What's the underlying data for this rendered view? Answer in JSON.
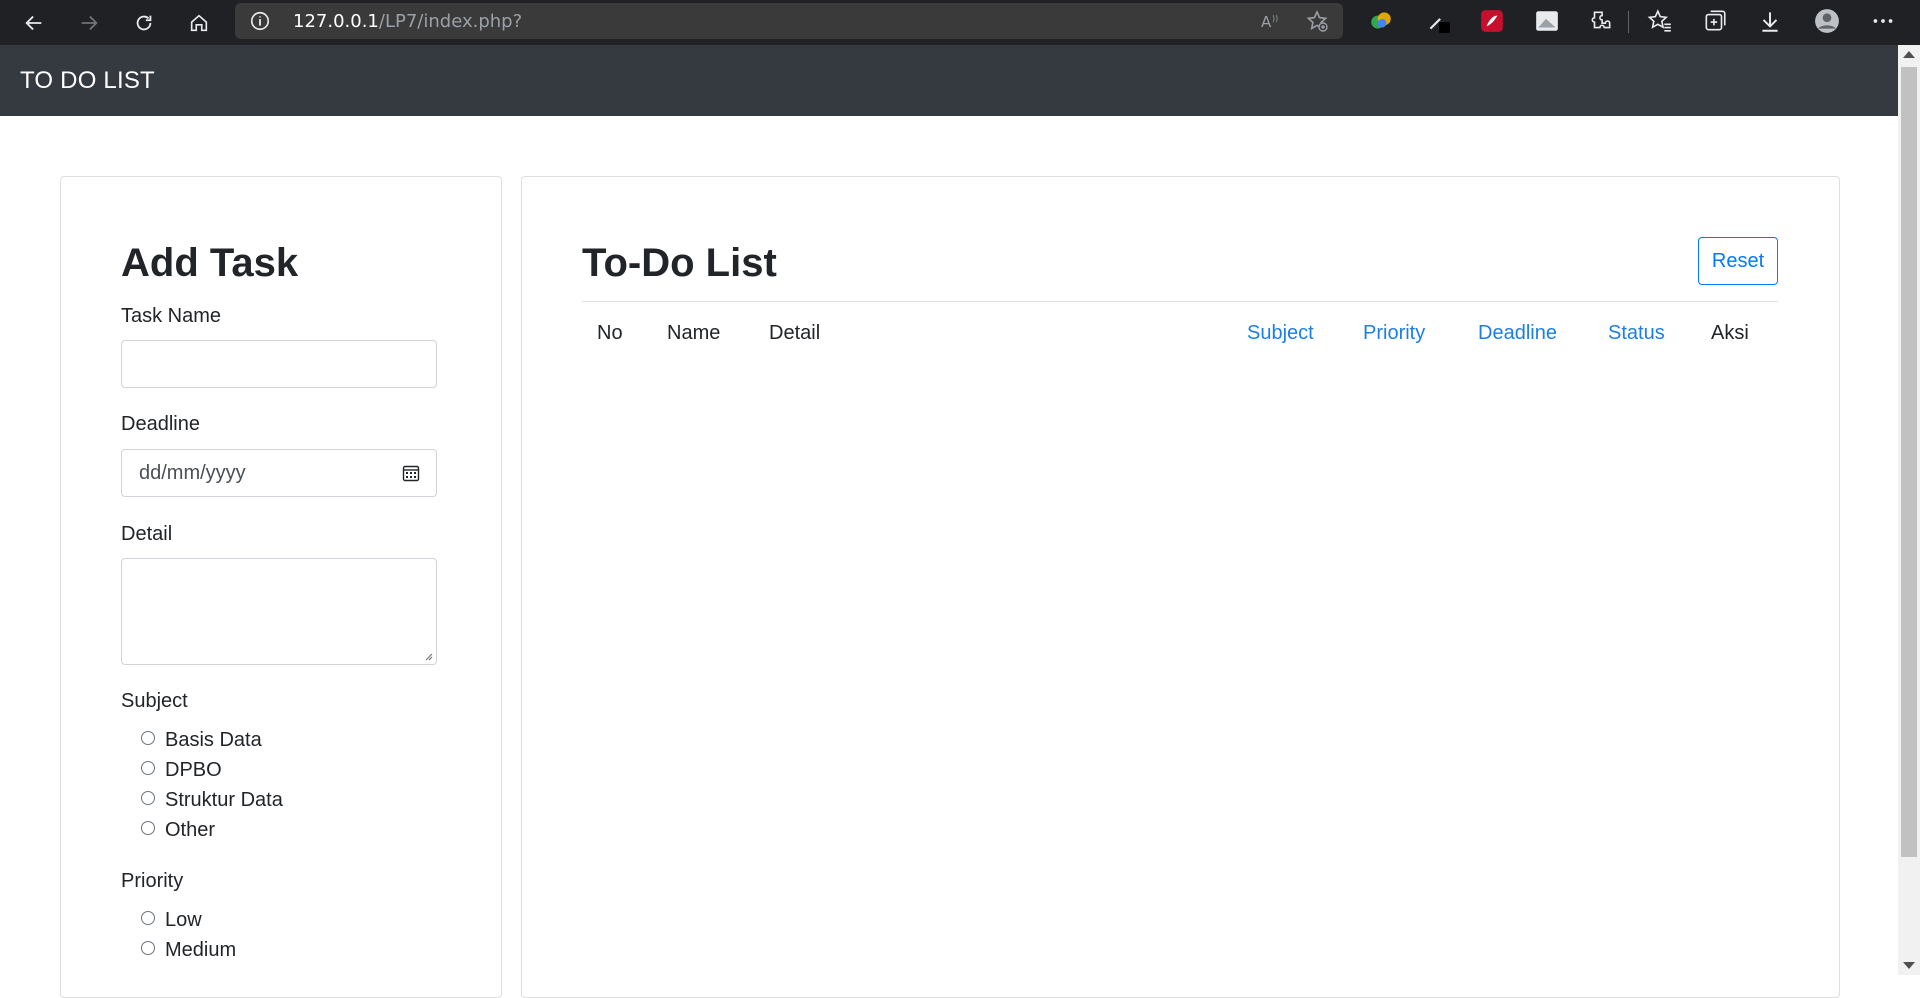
{
  "browser": {
    "url_host": "127.0.0.1",
    "url_path": "/LP7/index.php?"
  },
  "navbar": {
    "brand": "TO DO LIST"
  },
  "add_task": {
    "title": "Add Task",
    "task_name_label": "Task Name",
    "task_name_value": "",
    "deadline_label": "Deadline",
    "deadline_placeholder": "dd/mm/yyyy",
    "detail_label": "Detail",
    "detail_value": "",
    "subject_label": "Subject",
    "subjects": [
      {
        "label": "Basis Data",
        "checked": false
      },
      {
        "label": "DPBO",
        "checked": false
      },
      {
        "label": "Struktur Data",
        "checked": false
      },
      {
        "label": "Other",
        "checked": false
      }
    ],
    "priority_label": "Priority",
    "priorities": [
      {
        "label": "Low",
        "checked": false
      },
      {
        "label": "Medium",
        "checked": false
      }
    ]
  },
  "todo_list": {
    "title": "To-Do List",
    "reset_label": "Reset",
    "columns": [
      {
        "label": "No",
        "sortable": false
      },
      {
        "label": "Name",
        "sortable": false
      },
      {
        "label": "Detail",
        "sortable": false
      },
      {
        "label": "Subject",
        "sortable": true
      },
      {
        "label": "Priority",
        "sortable": true
      },
      {
        "label": "Deadline",
        "sortable": true
      },
      {
        "label": "Status",
        "sortable": true
      },
      {
        "label": "Aksi",
        "sortable": false
      }
    ],
    "rows": []
  },
  "colors": {
    "navbar_bg": "#343a40",
    "link": "#1e7fe3",
    "primary": "#007bff",
    "chrome_bg": "#202124"
  }
}
